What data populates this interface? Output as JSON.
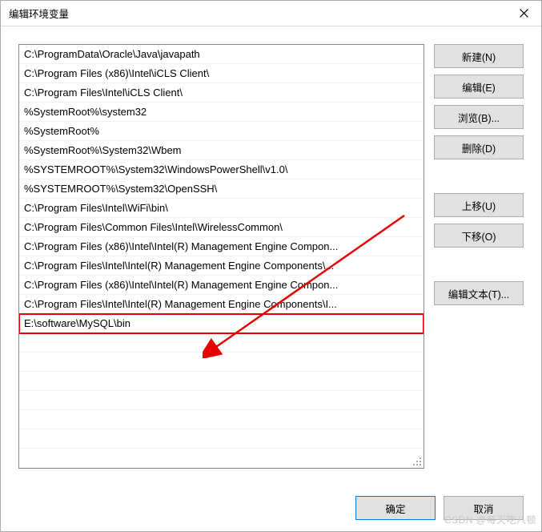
{
  "window": {
    "title": "编辑环境变量"
  },
  "paths": [
    "C:\\ProgramData\\Oracle\\Java\\javapath",
    "C:\\Program Files (x86)\\Intel\\iCLS Client\\",
    "C:\\Program Files\\Intel\\iCLS Client\\",
    "%SystemRoot%\\system32",
    "%SystemRoot%",
    "%SystemRoot%\\System32\\Wbem",
    "%SYSTEMROOT%\\System32\\WindowsPowerShell\\v1.0\\",
    "%SYSTEMROOT%\\System32\\OpenSSH\\",
    "C:\\Program Files\\Intel\\WiFi\\bin\\",
    "C:\\Program Files\\Common Files\\Intel\\WirelessCommon\\",
    "C:\\Program Files (x86)\\Intel\\Intel(R) Management Engine Compon...",
    "C:\\Program Files\\Intel\\Intel(R) Management Engine Components\\...",
    "C:\\Program Files (x86)\\Intel\\Intel(R) Management Engine Compon...",
    "C:\\Program Files\\Intel\\Intel(R) Management Engine Components\\I...",
    "E:\\software\\MySQL\\bin"
  ],
  "highlightIndex": 14,
  "buttons": {
    "new": "新建(N)",
    "edit": "编辑(E)",
    "browse": "浏览(B)...",
    "delete": "删除(D)",
    "moveUp": "上移(U)",
    "moveDown": "下移(O)",
    "editText": "编辑文本(T)...",
    "ok": "确定",
    "cancel": "取消"
  },
  "watermark": "CSDN @每天吃八顿"
}
